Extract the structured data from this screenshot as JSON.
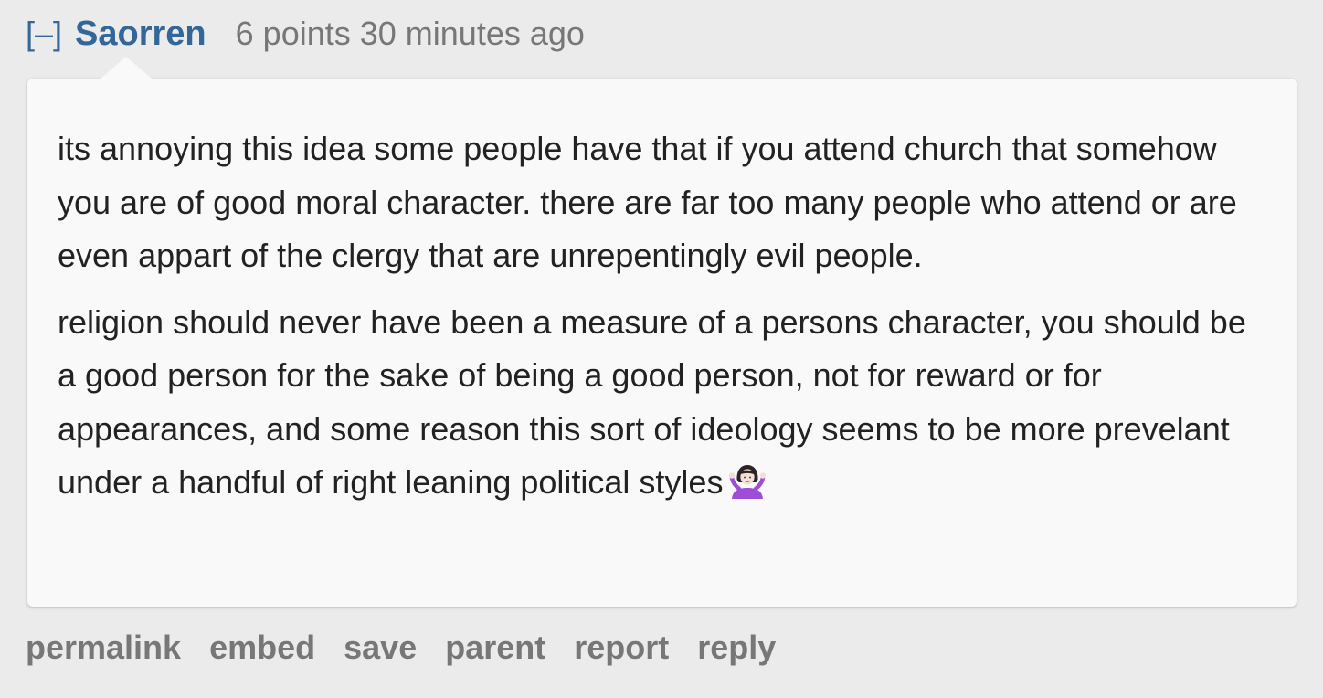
{
  "comment": {
    "collapse_toggle": "[–]",
    "author": "Saorren",
    "score": "6 points",
    "time": "30 minutes ago",
    "paragraphs": [
      "its annoying this idea some people have that if you attend church that somehow you are of good moral character. there are far too many people who attend or are even appart of the clergy that are unrepentingly evil people.",
      "religion should never have been a measure of a persons character, you should be a good person for the sake of being a good person, not for reward or for appearances, and some reason this sort of ideology seems to be more prevelant under a handful of right leaning political styles"
    ],
    "trailing_emoji": "person-shrugging-emoji",
    "colors": {
      "author_link": "#336699",
      "muted_text": "#777777",
      "body_text": "#222222",
      "page_background": "#ebebeb",
      "bubble_background": "#f9f9f9"
    }
  },
  "actions": {
    "permalink": "permalink",
    "embed": "embed",
    "save": "save",
    "parent": "parent",
    "report": "report",
    "reply": "reply"
  }
}
